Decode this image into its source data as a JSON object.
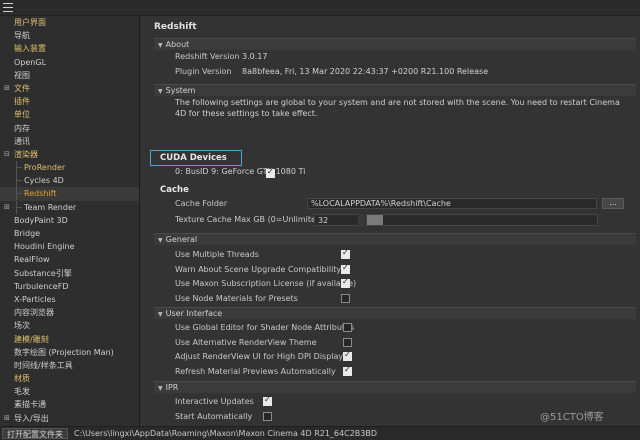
{
  "sidebar": {
    "items": [
      {
        "label": "用户界面",
        "level": 0,
        "tree": "",
        "style": "hl"
      },
      {
        "label": "导航",
        "level": 0,
        "tree": "",
        "style": ""
      },
      {
        "label": "输入装置",
        "level": 0,
        "tree": "",
        "style": "hl"
      },
      {
        "label": "OpenGL",
        "level": 0,
        "tree": "",
        "style": ""
      },
      {
        "label": "视图",
        "level": 0,
        "tree": "",
        "style": ""
      },
      {
        "label": "文件",
        "level": 0,
        "tree": "⊞",
        "style": "hl"
      },
      {
        "label": "插件",
        "level": 0,
        "tree": "",
        "style": "hl"
      },
      {
        "label": "单位",
        "level": 0,
        "tree": "",
        "style": "hl"
      },
      {
        "label": "内存",
        "level": 0,
        "tree": "",
        "style": ""
      },
      {
        "label": "通讯",
        "level": 0,
        "tree": "",
        "style": ""
      },
      {
        "label": "渲染器",
        "level": 0,
        "tree": "⊟",
        "style": "hl"
      },
      {
        "label": "ProRender",
        "level": 1,
        "tree": "",
        "style": "hl"
      },
      {
        "label": "Cycles 4D",
        "level": 1,
        "tree": "",
        "style": ""
      },
      {
        "label": "Redshift",
        "level": 1,
        "tree": "",
        "style": "active"
      },
      {
        "label": "Team Render",
        "level": 1,
        "tree": "⊞",
        "style": ""
      },
      {
        "label": "BodyPaint 3D",
        "level": 0,
        "tree": "",
        "style": ""
      },
      {
        "label": "Bridge",
        "level": 0,
        "tree": "",
        "style": ""
      },
      {
        "label": "Houdini Engine",
        "level": 0,
        "tree": "",
        "style": ""
      },
      {
        "label": "RealFlow",
        "level": 0,
        "tree": "",
        "style": ""
      },
      {
        "label": "Substance引擎",
        "level": 0,
        "tree": "",
        "style": ""
      },
      {
        "label": "TurbulenceFD",
        "level": 0,
        "tree": "",
        "style": ""
      },
      {
        "label": "X-Particles",
        "level": 0,
        "tree": "",
        "style": ""
      },
      {
        "label": "内容浏览器",
        "level": 0,
        "tree": "",
        "style": ""
      },
      {
        "label": "场次",
        "level": 0,
        "tree": "",
        "style": ""
      },
      {
        "label": "建模/雕刻",
        "level": 0,
        "tree": "",
        "style": "hl"
      },
      {
        "label": "数字绘图 (Projection Man)",
        "level": 0,
        "tree": "",
        "style": ""
      },
      {
        "label": "时间线/样条工具",
        "level": 0,
        "tree": "",
        "style": ""
      },
      {
        "label": "材质",
        "level": 0,
        "tree": "",
        "style": "hl"
      },
      {
        "label": "毛发",
        "level": 0,
        "tree": "",
        "style": ""
      },
      {
        "label": "素描卡通",
        "level": 0,
        "tree": "",
        "style": ""
      },
      {
        "label": "导入/导出",
        "level": 0,
        "tree": "⊞",
        "style": ""
      }
    ]
  },
  "main": {
    "title": "Redshift",
    "about": {
      "header": "About",
      "version_label": "Redshift Version",
      "version_value": "3.0.17",
      "plugin_label": "Plugin Version",
      "plugin_value": "8a8bfeea, Fri, 13 Mar 2020 22:43:37 +0200 R21.100 Release"
    },
    "system": {
      "header": "System",
      "text": "The following settings are global to your system and are not stored with the scene. You need to restart Cinema 4D for these settings to take effect."
    },
    "cuda": {
      "title": "CUDA Devices",
      "device": "0: BusID 9: GeForce GTX 1080 Ti",
      "device_checked": true
    },
    "cache": {
      "title": "Cache",
      "folder_label": "Cache Folder",
      "folder_value": "%LOCALAPPDATA%\\Redshift\\Cache",
      "browse_label": "...",
      "texture_label": "Texture Cache Max GB (0=Unlimited)",
      "texture_value": "32",
      "texture_fraction": 0.07
    },
    "general": {
      "header": "General",
      "options": [
        {
          "label": "Use Multiple Threads",
          "checked": true
        },
        {
          "label": "Warn About Scene Upgrade Compatibility",
          "checked": true
        },
        {
          "label": "Use Maxon Subscription License (if available)",
          "checked": true
        },
        {
          "label": "Use Node Materials for Presets",
          "checked": false
        }
      ]
    },
    "user_interface": {
      "header": "User Interface",
      "options": [
        {
          "label": "Use Global Editor for Shader Node Attributes",
          "checked": false
        },
        {
          "label": "Use Alternative RenderView Theme",
          "checked": false
        },
        {
          "label": "Adjust RenderView UI for High DPI Displays",
          "checked": true
        },
        {
          "label": "Refresh Material Previews Automatically",
          "checked": true
        }
      ]
    },
    "ipr": {
      "header": "IPR",
      "options": [
        {
          "label": "Interactive Updates",
          "checked": true
        },
        {
          "label": "Start Automatically",
          "checked": false
        }
      ]
    }
  },
  "status": {
    "button_label": "打开配置文件夹",
    "path": "C:\\Users\\lingxi\\AppData\\Roaming\\Maxon\\Maxon Cinema 4D R21_64C2B3BD"
  },
  "watermark": "@51CTO博客"
}
